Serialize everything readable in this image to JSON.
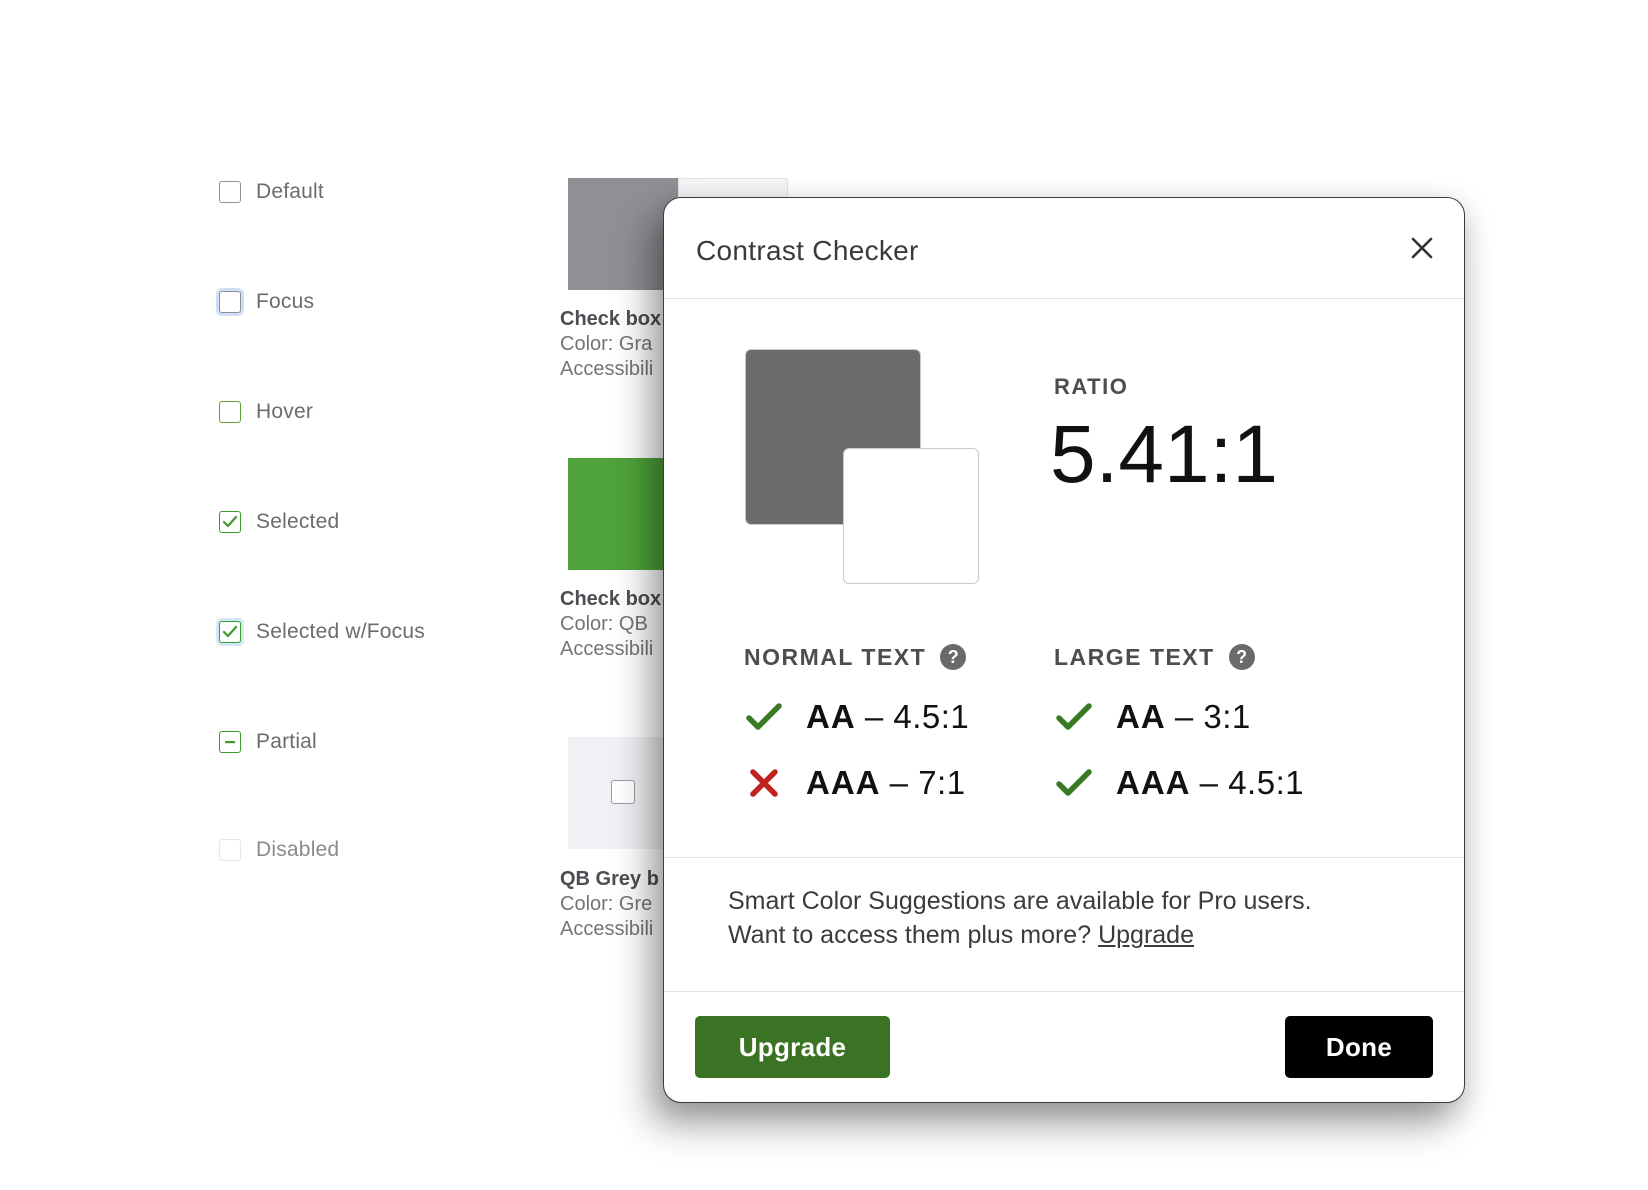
{
  "background": {
    "states": [
      {
        "label": "Default"
      },
      {
        "label": "Focus"
      },
      {
        "label": "Hover"
      },
      {
        "label": "Selected"
      },
      {
        "label": "Selected w/Focus"
      },
      {
        "label": "Partial"
      },
      {
        "label": "Disabled"
      }
    ],
    "captions": [
      {
        "title": "Check box",
        "line1": "Color: Gra",
        "line2": "Accessibili"
      },
      {
        "title": "Check box",
        "line1": "Color: QB",
        "line2": "Accessibili"
      },
      {
        "title": "QB Grey b",
        "line1": "Color: Gre",
        "line2": "Accessibili"
      }
    ],
    "colors": {
      "gray_swatch": "#8e9096",
      "green_swatch": "#4fa33a",
      "light_swatch": "#f0f1f4"
    }
  },
  "modal": {
    "title": "Contrast Checker",
    "close_icon": "close-icon",
    "preview": {
      "background_color": "#6b6b6d",
      "foreground_color": "#ffffff"
    },
    "ratio_label": "RATIO",
    "ratio_value": "5.41:1",
    "normal_text": {
      "heading": "NORMAL TEXT",
      "help_icon": "?",
      "checks": [
        {
          "level": "AA",
          "requirement": "– 4.5:1",
          "pass": true
        },
        {
          "level": "AAA",
          "requirement": "– 7:1",
          "pass": false
        }
      ]
    },
    "large_text": {
      "heading": "LARGE TEXT",
      "help_icon": "?",
      "checks": [
        {
          "level": "AA",
          "requirement": "– 3:1",
          "pass": true
        },
        {
          "level": "AAA",
          "requirement": "– 4.5:1",
          "pass": true
        }
      ]
    },
    "promo": {
      "line1": "Smart Color Suggestions are available for Pro users.",
      "line2": "Want to access them plus more?",
      "link": "Upgrade"
    },
    "buttons": {
      "upgrade": "Upgrade",
      "done": "Done"
    },
    "colors": {
      "pass": "#3a7a25",
      "fail": "#c0231d",
      "upgrade_button": "#3a7323",
      "done_button": "#000000"
    }
  }
}
